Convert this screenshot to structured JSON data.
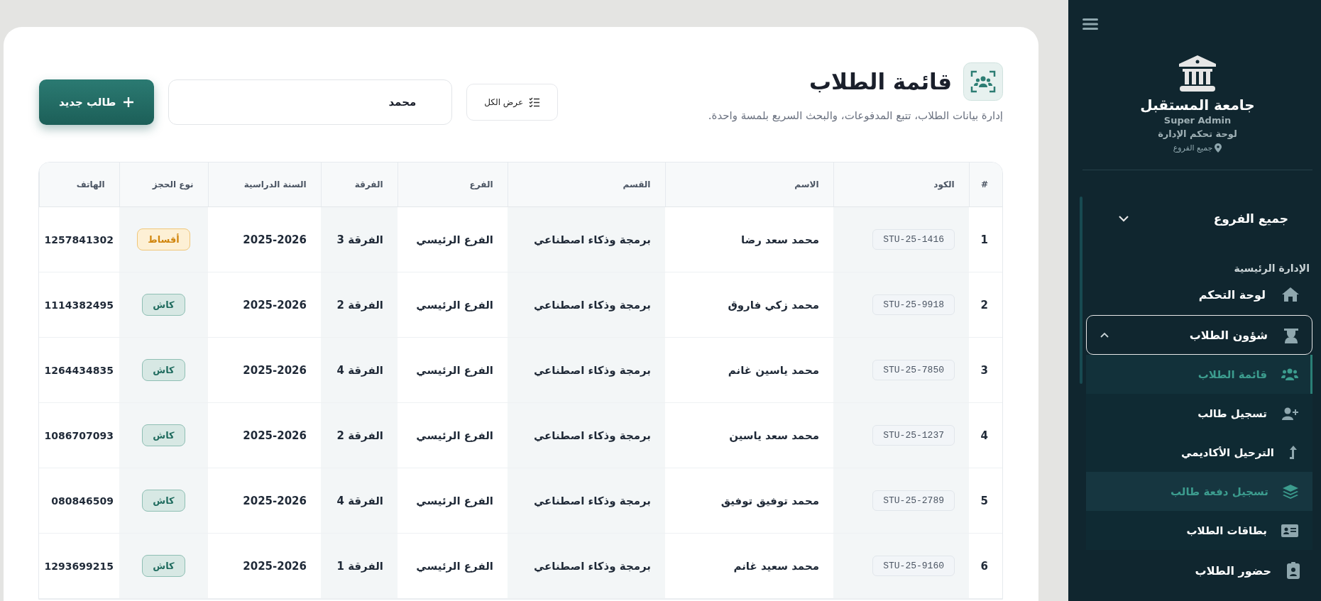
{
  "header": {
    "title": "قائمة الطلاب",
    "subtitle": "إدارة بيانات الطلاب، تتبع المدفوعات، والبحث السريع بلمسة واحدة.",
    "show_all_button": "عرض الكل",
    "search": {
      "value": "محمد"
    },
    "new_button": "طالب جديد"
  },
  "table": {
    "columns": [
      "#",
      "الكود",
      "الاسم",
      "القسم",
      "الفرع",
      "الفرقة",
      "السنة الدراسية",
      "نوع الحجز",
      "الهاتف"
    ],
    "rows": [
      {
        "num": "1",
        "code": "STU-25-1416",
        "name": "محمد سعد رضا",
        "department": "برمجة وذكاء اصطناعي",
        "branch": "الفرع الرئيسي",
        "group": "الفرقة 3",
        "year": "2025-2026",
        "booking": {
          "label": "أقساط",
          "kind": "installments"
        },
        "phone": "1257841302"
      },
      {
        "num": "2",
        "code": "STU-25-9918",
        "name": "محمد زكي فاروق",
        "department": "برمجة وذكاء اصطناعي",
        "branch": "الفرع الرئيسي",
        "group": "الفرقة 2",
        "year": "2025-2026",
        "booking": {
          "label": "كاش",
          "kind": "cash"
        },
        "phone": "1114382495"
      },
      {
        "num": "3",
        "code": "STU-25-7850",
        "name": "محمد ياسين غانم",
        "department": "برمجة وذكاء اصطناعي",
        "branch": "الفرع الرئيسي",
        "group": "الفرقة 4",
        "year": "2025-2026",
        "booking": {
          "label": "كاش",
          "kind": "cash"
        },
        "phone": "1264434835"
      },
      {
        "num": "4",
        "code": "STU-25-1237",
        "name": "محمد سعد ياسين",
        "department": "برمجة وذكاء اصطناعي",
        "branch": "الفرع الرئيسي",
        "group": "الفرقة 2",
        "year": "2025-2026",
        "booking": {
          "label": "كاش",
          "kind": "cash"
        },
        "phone": "1086707093"
      },
      {
        "num": "5",
        "code": "STU-25-2789",
        "name": "محمد توفيق توفيق",
        "department": "برمجة وذكاء اصطناعي",
        "branch": "الفرع الرئيسي",
        "group": "الفرقة 4",
        "year": "2025-2026",
        "booking": {
          "label": "كاش",
          "kind": "cash"
        },
        "phone": "080846509"
      },
      {
        "num": "6",
        "code": "STU-25-9160",
        "name": "محمد سعيد غانم",
        "department": "برمجة وذكاء اصطناعي",
        "branch": "الفرع الرئيسي",
        "group": "الفرقة 1",
        "year": "2025-2026",
        "booking": {
          "label": "كاش",
          "kind": "cash"
        },
        "phone": "1293699215"
      }
    ]
  },
  "sidebar": {
    "brand": "جامعة المستقبل",
    "role": "Super Admin",
    "subtitle": "لوحة تحكم الإدارة",
    "location": "جميع الفروع",
    "branch_select": {
      "value": "جميع الفروع",
      "expanded": false
    },
    "section_label": "الإدارة الرئيسية",
    "items": [
      {
        "label": "لوحة التحكم"
      },
      {
        "label": "شؤون الطلاب",
        "expanded": true,
        "children": [
          {
            "label": "قائمة الطلاب",
            "selected": true,
            "hovered": false
          },
          {
            "label": "تسجيل طالب",
            "selected": false,
            "hovered": false
          },
          {
            "label": "الترحيل الأكاديمي",
            "selected": false,
            "hovered": false
          },
          {
            "label": "تسجيل دفعة طالب",
            "selected": false,
            "hovered": true
          },
          {
            "label": "بطاقات الطلاب",
            "selected": false,
            "hovered": false
          }
        ]
      },
      {
        "label": "حضور الطلاب"
      }
    ]
  }
}
